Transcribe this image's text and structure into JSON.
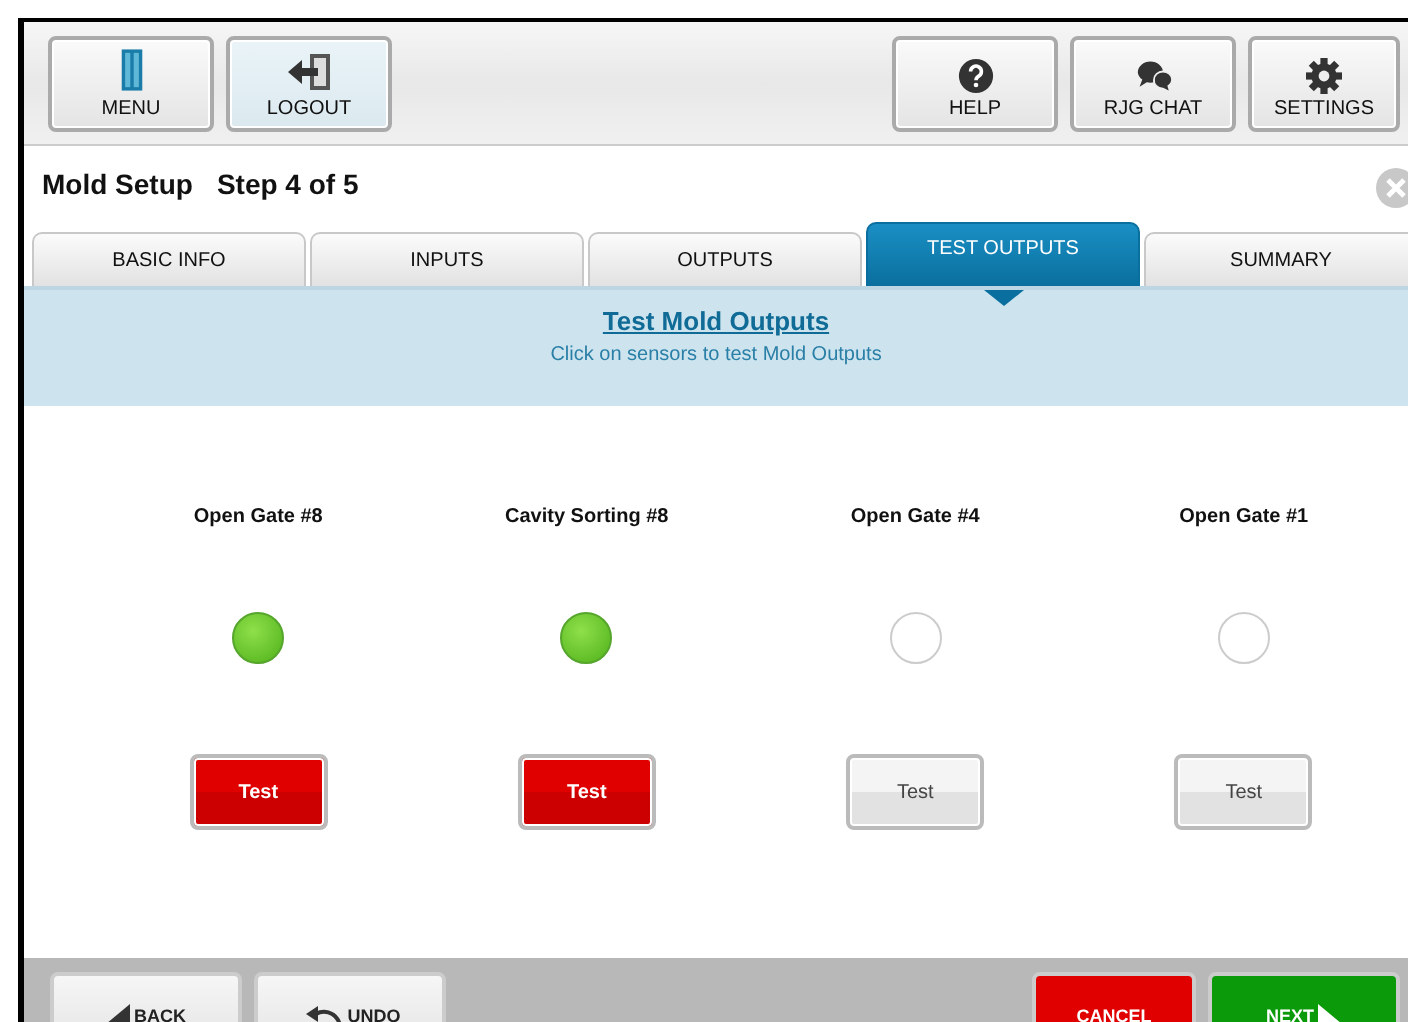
{
  "toolbar": {
    "left": [
      {
        "label": "MENU",
        "kind": "menu",
        "selected": false
      },
      {
        "label": "LOGOUT",
        "kind": "logout",
        "selected": true
      }
    ],
    "right": [
      {
        "label": "HELP",
        "kind": "help"
      },
      {
        "label": "RJG CHAT",
        "kind": "chat"
      },
      {
        "label": "SETTINGS",
        "kind": "settings"
      }
    ]
  },
  "header": {
    "title": "Mold Setup",
    "step": "Step 4 of 5"
  },
  "tabs": [
    {
      "label": "BASIC INFO",
      "selected": false
    },
    {
      "label": "INPUTS",
      "selected": false
    },
    {
      "label": "OUTPUTS",
      "selected": false
    },
    {
      "label": "TEST OUTPUTS",
      "selected": true
    },
    {
      "label": "SUMMARY",
      "selected": false
    }
  ],
  "banner": {
    "title": "Test Mold Outputs",
    "subtitle": "Click on sensors to test Mold Outputs"
  },
  "outputs": [
    {
      "name": "Open Gate #8",
      "on": true,
      "button": "Test"
    },
    {
      "name": "Cavity Sorting #8",
      "on": true,
      "button": "Test"
    },
    {
      "name": "Open Gate #4",
      "on": false,
      "button": "Test"
    },
    {
      "name": "Open Gate #1",
      "on": false,
      "button": "Test"
    }
  ],
  "footer": {
    "left": [
      {
        "label": "BACK",
        "kind": "back"
      },
      {
        "label": "UNDO",
        "kind": "undo"
      }
    ],
    "right": [
      {
        "label": "CANCEL",
        "kind": "cancel"
      },
      {
        "label": "NEXT",
        "kind": "next"
      }
    ]
  }
}
